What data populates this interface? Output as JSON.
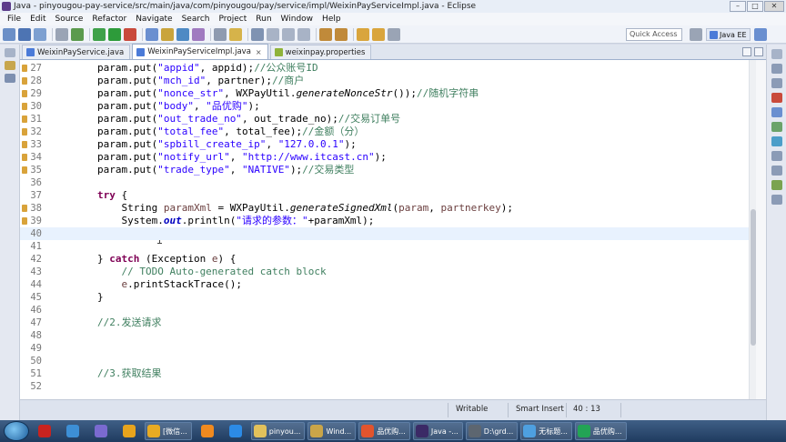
{
  "window": {
    "title": "Java - pinyougou-pay-service/src/main/java/com/pinyougou/pay/service/impl/WeixinPayServiceImpl.java - Eclipse"
  },
  "menu": [
    "File",
    "Edit",
    "Source",
    "Refactor",
    "Navigate",
    "Search",
    "Project",
    "Run",
    "Window",
    "Help"
  ],
  "toolbar": {
    "quick_access": "Quick Access",
    "perspective": "Java EE"
  },
  "tabs": [
    {
      "label": "WeixinPayService.java",
      "active": false,
      "icon": "java-file-icon"
    },
    {
      "label": "WeixinPayServiceImpl.java",
      "active": true,
      "icon": "java-file-icon",
      "close": "×"
    },
    {
      "label": "weixinpay.properties",
      "active": false,
      "icon": "properties-file-icon"
    }
  ],
  "editor": {
    "lines": [
      {
        "n": "27",
        "marker": true,
        "segs": [
          [
            "p",
            "        param.put("
          ],
          [
            "s",
            "\"appid\""
          ],
          [
            "p",
            ", appid);"
          ],
          [
            "c",
            "//公众账号ID"
          ]
        ]
      },
      {
        "n": "28",
        "marker": true,
        "segs": [
          [
            "p",
            "        param.put("
          ],
          [
            "s",
            "\"mch_id\""
          ],
          [
            "p",
            ", partner);"
          ],
          [
            "c",
            "//商户"
          ]
        ]
      },
      {
        "n": "29",
        "marker": true,
        "segs": [
          [
            "p",
            "        param.put("
          ],
          [
            "s",
            "\"nonce_str\""
          ],
          [
            "p",
            ", WXPayUtil."
          ],
          [
            "i",
            "generateNonceStr"
          ],
          [
            "p",
            "());"
          ],
          [
            "c",
            "//随机字符串"
          ]
        ]
      },
      {
        "n": "30",
        "marker": true,
        "segs": [
          [
            "p",
            "        param.put("
          ],
          [
            "s",
            "\"body\""
          ],
          [
            "p",
            ", "
          ],
          [
            "s",
            "\"品优购\""
          ],
          [
            "p",
            ");"
          ]
        ]
      },
      {
        "n": "31",
        "marker": true,
        "segs": [
          [
            "p",
            "        param.put("
          ],
          [
            "s",
            "\"out_trade_no\""
          ],
          [
            "p",
            ", out_trade_no);"
          ],
          [
            "c",
            "//交易订单号"
          ]
        ]
      },
      {
        "n": "32",
        "marker": true,
        "segs": [
          [
            "p",
            "        param.put("
          ],
          [
            "s",
            "\"total_fee\""
          ],
          [
            "p",
            ", total_fee);"
          ],
          [
            "c",
            "//金额（分）"
          ]
        ]
      },
      {
        "n": "33",
        "marker": true,
        "segs": [
          [
            "p",
            "        param.put("
          ],
          [
            "s",
            "\"spbill_create_ip\""
          ],
          [
            "p",
            ", "
          ],
          [
            "s",
            "\"127.0.0.1\""
          ],
          [
            "p",
            ");"
          ]
        ]
      },
      {
        "n": "34",
        "marker": true,
        "segs": [
          [
            "p",
            "        param.put("
          ],
          [
            "s",
            "\"notify_url\""
          ],
          [
            "p",
            ", "
          ],
          [
            "s",
            "\"http://www.itcast.cn\""
          ],
          [
            "p",
            ");"
          ]
        ]
      },
      {
        "n": "35",
        "marker": true,
        "segs": [
          [
            "p",
            "        param.put("
          ],
          [
            "s",
            "\"trade_type\""
          ],
          [
            "p",
            ", "
          ],
          [
            "s",
            "\"NATIVE\""
          ],
          [
            "p",
            ");"
          ],
          [
            "c",
            "//交易类型"
          ]
        ]
      },
      {
        "n": "36",
        "marker": false,
        "segs": []
      },
      {
        "n": "37",
        "marker": false,
        "segs": [
          [
            "p",
            "        "
          ],
          [
            "k",
            "try"
          ],
          [
            "p",
            " {"
          ]
        ]
      },
      {
        "n": "38",
        "marker": true,
        "segs": [
          [
            "p",
            "            String "
          ],
          [
            "v",
            "paramXml"
          ],
          [
            "p",
            " = WXPayUtil."
          ],
          [
            "i",
            "generateSignedXml"
          ],
          [
            "p",
            "("
          ],
          [
            "v",
            "param"
          ],
          [
            "p",
            ", "
          ],
          [
            "v",
            "partnerkey"
          ],
          [
            "p",
            ");"
          ]
        ]
      },
      {
        "n": "39",
        "marker": true,
        "segs": [
          [
            "p",
            "            System."
          ],
          [
            "f",
            "out"
          ],
          [
            "p",
            ".println("
          ],
          [
            "s",
            "\"请求的参数：\""
          ],
          [
            "p",
            "+paramXml);"
          ]
        ]
      },
      {
        "n": "40",
        "marker": false,
        "current": true,
        "segs": []
      },
      {
        "n": "41",
        "marker": false,
        "segs": []
      },
      {
        "n": "42",
        "marker": false,
        "segs": [
          [
            "p",
            "        } "
          ],
          [
            "k",
            "catch"
          ],
          [
            "p",
            " (Exception "
          ],
          [
            "v",
            "e"
          ],
          [
            "p",
            ") {"
          ]
        ]
      },
      {
        "n": "43",
        "marker": false,
        "segs": [
          [
            "c",
            "            // TODO Auto-generated catch block"
          ]
        ]
      },
      {
        "n": "44",
        "marker": false,
        "segs": [
          [
            "p",
            "            "
          ],
          [
            "v",
            "e"
          ],
          [
            "p",
            ".printStackTrace();"
          ]
        ]
      },
      {
        "n": "45",
        "marker": false,
        "segs": [
          [
            "p",
            "        }"
          ]
        ]
      },
      {
        "n": "46",
        "marker": false,
        "segs": []
      },
      {
        "n": "47",
        "marker": false,
        "segs": [
          [
            "c",
            "        //2.发送请求"
          ]
        ]
      },
      {
        "n": "48",
        "marker": false,
        "segs": []
      },
      {
        "n": "49",
        "marker": false,
        "segs": []
      },
      {
        "n": "50",
        "marker": false,
        "segs": []
      },
      {
        "n": "51",
        "marker": false,
        "segs": [
          [
            "c",
            "        //3.获取结果"
          ]
        ]
      },
      {
        "n": "52",
        "marker": false,
        "segs": []
      }
    ]
  },
  "status": {
    "mode": "Writable",
    "insert": "Smart Insert",
    "position": "40 : 13"
  },
  "taskbar": {
    "apps": [
      {
        "label": "",
        "icon": "record-icon",
        "color": "#c8231f",
        "pin": true
      },
      {
        "label": "",
        "icon": "app-grid-icon",
        "color": "#3d8fd6",
        "pin": true
      },
      {
        "label": "",
        "icon": "feather-icon",
        "color": "#7a6ad0",
        "pin": true
      },
      {
        "label": "",
        "icon": "chrome-icon",
        "color": "#e8a41c",
        "pin": true
      },
      {
        "label": "[微信...",
        "icon": "wechat-window-icon",
        "color": "#e8ab23",
        "pin": false
      },
      {
        "label": "",
        "icon": "taobao-icon",
        "color": "#f08a1f",
        "pin": true
      },
      {
        "label": "",
        "icon": "qq-browser-icon",
        "color": "#2c8be6",
        "pin": true
      },
      {
        "label": "pinyou...",
        "icon": "folder-icon",
        "color": "#e2c15b",
        "pin": false
      },
      {
        "label": "Wind...",
        "icon": "explorer-icon",
        "color": "#caa548",
        "pin": false
      },
      {
        "label": "品优购...",
        "icon": "pdf-icon",
        "color": "#e2542d",
        "pin": false
      },
      {
        "label": "Java -...",
        "icon": "eclipse-icon",
        "color": "#3b2a66",
        "pin": false
      },
      {
        "label": "D:\\grd...",
        "icon": "terminal-icon",
        "color": "#5d6670",
        "pin": false
      },
      {
        "label": "无标题...",
        "icon": "paint-icon",
        "color": "#4ea0e0",
        "pin": false
      },
      {
        "label": "品优购...",
        "icon": "sheet-icon",
        "color": "#23a455",
        "pin": false
      }
    ]
  }
}
